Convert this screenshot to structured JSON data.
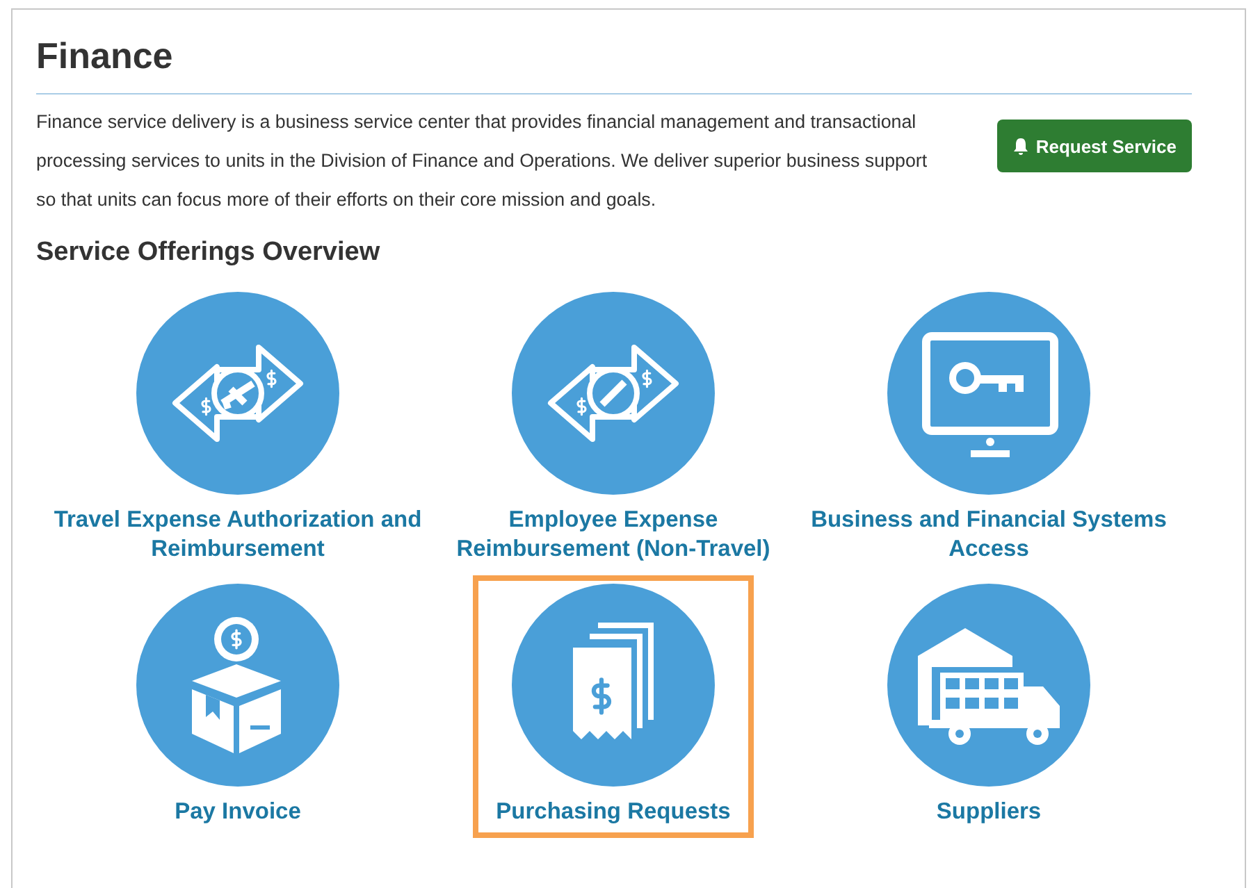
{
  "page": {
    "title": "Finance"
  },
  "intro": {
    "text": "Finance service delivery is a business service center that provides financial management and transactional processing services to units in the Division of Finance and Operations. We deliver superior business support so that units can focus more of their efforts on their core mission and goals.",
    "button": "Request Service"
  },
  "section": {
    "title": "Service Offerings Overview"
  },
  "services": [
    {
      "label": "Travel Expense Authorization and Reimbursement",
      "kind": "travel",
      "highlighted": false
    },
    {
      "label": "Employee Expense Reimbursement (Non-Travel)",
      "kind": "expense",
      "highlighted": false
    },
    {
      "label": "Business and Financial Systems Access",
      "kind": "systems",
      "highlighted": false
    },
    {
      "label": "Pay Invoice",
      "kind": "invoice",
      "highlighted": false
    },
    {
      "label": "Purchasing Requests",
      "kind": "purchasing",
      "highlighted": true
    },
    {
      "label": "Suppliers",
      "kind": "suppliers",
      "highlighted": false
    }
  ]
}
